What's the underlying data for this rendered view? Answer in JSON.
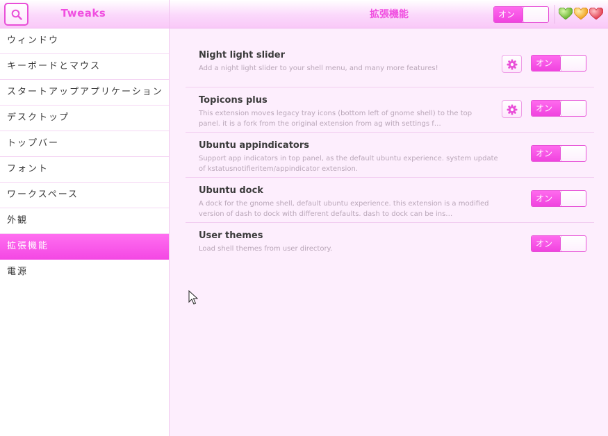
{
  "app": {
    "title": "Tweaks",
    "page_title": "拡張機能",
    "global_toggle": {
      "label": "オン",
      "state": "on"
    }
  },
  "window_controls": [
    {
      "name": "minimize",
      "color": "#77c63a"
    },
    {
      "name": "maximize",
      "color": "#f5a623"
    },
    {
      "name": "close",
      "color": "#ef4b5b"
    }
  ],
  "sidebar": {
    "items": [
      {
        "label": "ウィンドウ",
        "active": false
      },
      {
        "label": "キーボードとマウス",
        "active": false
      },
      {
        "label": "スタートアップアプリケーション",
        "active": false
      },
      {
        "label": "デスクトップ",
        "active": false
      },
      {
        "label": "トップバー",
        "active": false
      },
      {
        "label": "フォント",
        "active": false
      },
      {
        "label": "ワークスペース",
        "active": false
      },
      {
        "label": "外観",
        "active": false
      },
      {
        "label": "拡張機能",
        "active": true
      },
      {
        "label": "電源",
        "active": false
      }
    ]
  },
  "extensions": [
    {
      "name": "Night light slider",
      "description": "Add a night light slider to your shell menu, and many more features!",
      "has_settings": true,
      "toggle_label": "オン"
    },
    {
      "name": "Topicons plus",
      "description": "This extension moves legacy tray icons (bottom left of gnome shell) to the top panel. it is a fork from the original extension from ag with settings f…",
      "has_settings": true,
      "toggle_label": "オン"
    },
    {
      "name": "Ubuntu appindicators",
      "description": "Support app indicators in top panel, as the default ubuntu experience. system update of kstatusnotifieritem/appindicator extension.",
      "has_settings": false,
      "toggle_label": "オン"
    },
    {
      "name": "Ubuntu dock",
      "description": "A dock for the gnome shell, default ubuntu experience. this extension is a modified version of dash to dock with different defaults. dash to dock can be ins…",
      "has_settings": false,
      "toggle_label": "オン"
    },
    {
      "name": "User themes",
      "description": "Load shell themes from user directory.",
      "has_settings": false,
      "toggle_label": "オン"
    }
  ],
  "colors": {
    "accent": "#f04fe0",
    "background": "#fdeefd",
    "sidebar_bg": "#ffffff"
  }
}
